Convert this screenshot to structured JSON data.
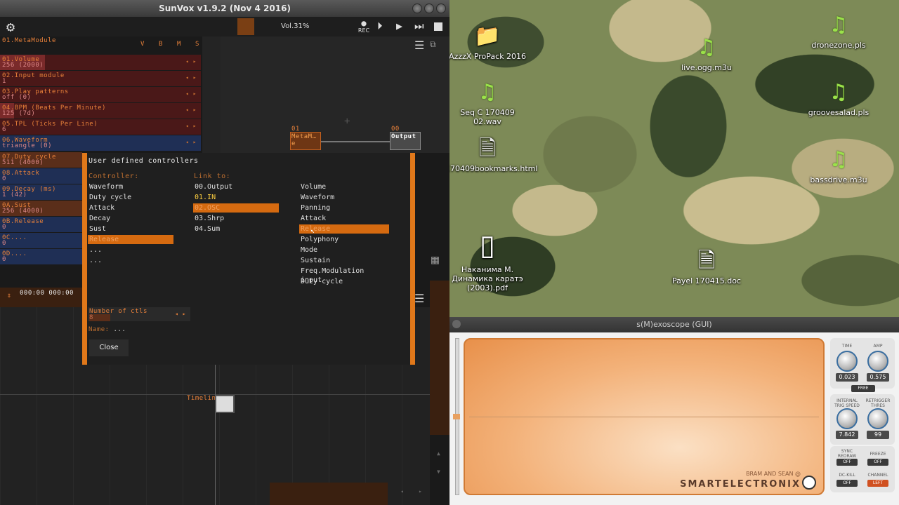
{
  "sunvox": {
    "title": "SunVox v1.9.2 (Nov  4 2016)",
    "volume": "Vol.31%",
    "rec_label": "REC",
    "module_name": "01.MetaModule",
    "vbms": [
      "V",
      "B",
      "M",
      "S"
    ],
    "controllers": [
      {
        "name": "01.Volume",
        "value": "256 (2000)"
      },
      {
        "name": "02.Input module",
        "value": "1"
      },
      {
        "name": "03.Play patterns",
        "value": "off (0)"
      },
      {
        "name": "04.BPM (Beats Per Minute)",
        "value": "125 (7d)"
      },
      {
        "name": "05.TPL (Ticks Per Line)",
        "value": "6"
      },
      {
        "name": "06.Waveform",
        "value": "triangle (0)"
      },
      {
        "name": "07.Duty cycle",
        "value": "511 (4000)"
      },
      {
        "name": "08.Attack",
        "value": "0"
      },
      {
        "name": "09.Decay (ms)",
        "value": "1 (42)"
      },
      {
        "name": "0A.Sust",
        "value": "256 (4000)"
      },
      {
        "name": "0B.Release",
        "value": "0"
      },
      {
        "name": "0C....",
        "value": "0"
      },
      {
        "name": "0D....",
        "value": "0"
      }
    ],
    "time_display": "000:00  000:00",
    "node_meta_num": "01",
    "node_meta_label": "MetaM…e",
    "node_out_num": "00",
    "node_out_label": "Output",
    "timeline_label": "Timeline:",
    "dialog": {
      "title": "User defined controllers",
      "controller_header": "Controller:",
      "link_header": "Link to:",
      "controllers": [
        "Waveform",
        "Duty cycle",
        "Attack",
        "Decay",
        "Sust",
        "Release",
        "...",
        "..."
      ],
      "links": [
        "00.Output",
        "01.IN",
        "02.OSC",
        "03.Shrp",
        "04.Sum"
      ],
      "params": [
        "Volume",
        "Waveform",
        "Panning",
        "Attack",
        "Release",
        "Polyphony",
        "Mode",
        "Sustain",
        "Freq.Modulation input",
        "Duty cycle"
      ],
      "num_ctls_label": "Number of ctls",
      "num_ctls_value": "8",
      "name_label": "Name:",
      "name_value": "...",
      "close_label": "Close"
    }
  },
  "desktop": {
    "icons": [
      {
        "label": "AzzzX ProPack 2016",
        "icon": "folder-icon"
      },
      {
        "label": "dronezone.pls",
        "icon": "music-note-icon"
      },
      {
        "label": "live.ogg.m3u",
        "icon": "music-note-icon"
      },
      {
        "label": "Seq C 170409 02.wav",
        "icon": "music-note-icon"
      },
      {
        "label": "groovesalad.pls",
        "icon": "music-note-icon"
      },
      {
        "label": "170409bookmarks.html",
        "icon": "web-page-icon"
      },
      {
        "label": "bassdrive.m3u",
        "icon": "music-note-icon"
      },
      {
        "label": "Наканима М. Динамика каратэ (2003).pdf",
        "icon": "pdf-icon"
      },
      {
        "label": "Payel 170415.doc",
        "icon": "document-icon"
      }
    ]
  },
  "scope": {
    "title": "s(M)exoscope (GUI)",
    "time_label": "TIME",
    "time_value": "0.023",
    "amp_label": "AMP",
    "amp_value": "0.575",
    "free_label": "FREE",
    "trig_label": "INTERNAL TRIG SPEED",
    "trig_value": "7.842",
    "retrig_label": "RETRIGGER THRES",
    "retrig_value": "99",
    "sync_label": "SYNC REDRAW",
    "sync_value": "OFF",
    "freeze_label": "FREEZE",
    "freeze_value": "OFF",
    "dckill_label": "DC-KILL",
    "dckill_value": "OFF",
    "channel_label": "CHANNEL",
    "channel_value": "LEFT",
    "brand_small": "BRAM AND SEAN @",
    "brand_big": "SMARTELECTRONIX"
  }
}
